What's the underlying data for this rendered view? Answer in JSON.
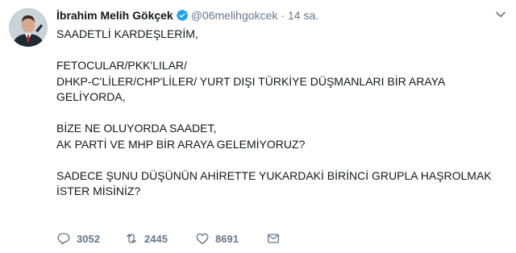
{
  "tweet": {
    "author_name": "İbrahim Melih Gökçek",
    "handle": "@06melihgokcek",
    "separator": "·",
    "time": "14 sa.",
    "lines": [
      "SAADETLİ KARDEŞLERİM,",
      "",
      "FETOCULAR/PKK'LILAR/",
      "DHKP-C'LİLER/CHP'LİLER/ YURT DIŞI TÜRKİYE DÜŞMANLARI BİR ARAYA GELİYORDA,",
      "",
      "BİZE NE OLUYORDA SAADET,",
      "AK PARTİ VE MHP BİR ARAYA GELEMİYORUZ?",
      "",
      "SADECE ŞUNU DÜŞÜNÜN AHİRETTE YUKARDAKİ BİRİNCİ GRUPLA HAŞROLMAK İSTER MİSİNİZ?"
    ],
    "actions": {
      "reply_count": "3052",
      "retweet_count": "2445",
      "like_count": "8691"
    }
  },
  "icons": {
    "verified": "verified-badge-icon",
    "caret": "chevron-down-icon",
    "reply": "reply-icon",
    "retweet": "retweet-icon",
    "like": "heart-icon",
    "dm": "envelope-icon"
  },
  "colors": {
    "verified": "#1da1f2",
    "muted": "#657786",
    "text": "#14171a"
  }
}
